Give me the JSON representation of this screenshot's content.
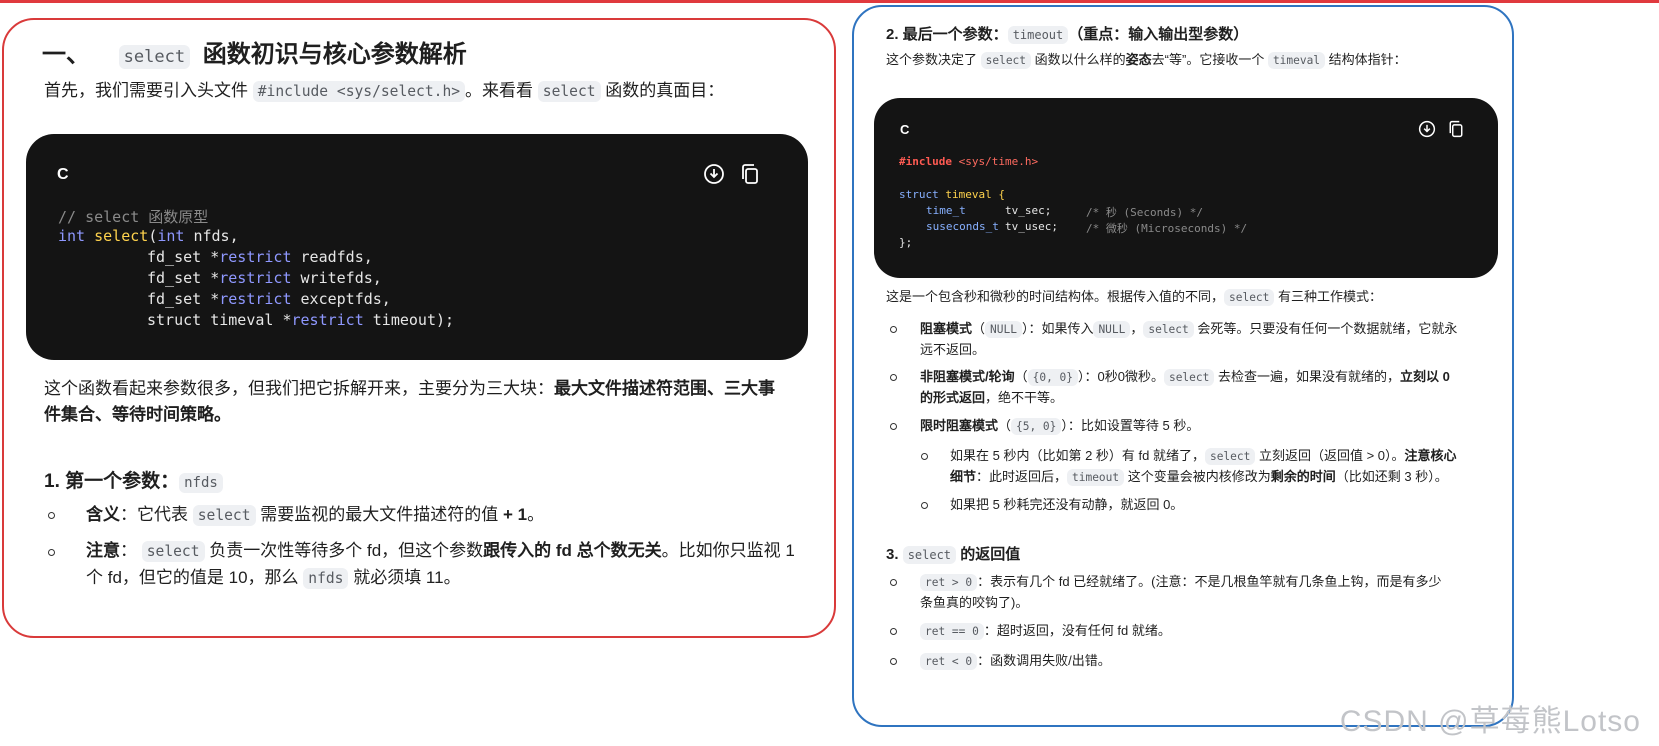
{
  "left": {
    "title_prefix": "一、",
    "title_code": "select",
    "title_suffix": "函数初识与核心参数解析",
    "intro_a": "首先，我们需要引入头文件",
    "intro_code1": "#include <sys/select.h>",
    "intro_b": "。来看看",
    "intro_code2": "select",
    "intro_c": "函数的真面目：",
    "code": {
      "lang": "C",
      "comment": "// select 函数原型",
      "l1_kw1": "int",
      "l1_fn": "select",
      "l1_paren": "(",
      "l1_kw2": "int",
      "l1_rest": " nfds,",
      "l2_a": "fd_set *",
      "l2_kw": "restrict",
      "l2_b": " readfds,",
      "l3_a": "fd_set *",
      "l3_kw": "restrict",
      "l3_b": " writefds,",
      "l4_a": "fd_set *",
      "l4_kw": "restrict",
      "l4_b": " exceptfds,",
      "l5_a": "struct timeval *",
      "l5_kw": "restrict",
      "l5_b": " timeout);"
    },
    "summary_a": "这个函数看起来参数很多，但我们把它拆解开来，主要分为三大块：",
    "summary_bold1": "最大文件描述符范围、三大事",
    "summary_bold2": "件集合、等待时间策略。",
    "sec1_prefix": "1. 第一个参数：",
    "sec1_code": "nfds",
    "item1_label": "含义",
    "item1_a": "：它代表",
    "item1_code": "select",
    "item1_b": "需要监视的最大文件描述符的值",
    "item1_bold": " + 1",
    "item1_c": "。",
    "item2_label": "注意",
    "item2_a": "：",
    "item2_code": "select",
    "item2_b": "负责一次性等待多个 fd，但这个参数",
    "item2_bold": "跟传入的 fd 总个数无关",
    "item2_c": "。比如你只监视 1",
    "item2_line2_a": "个 fd，但它的值是 10，那么",
    "item2_code2": "nfds",
    "item2_line2_b": "就必须填 11。"
  },
  "right": {
    "sec2_prefix": "2. 最后一个参数：",
    "sec2_code": "timeout",
    "sec2_suffix": "（重点：输入输出型参数）",
    "sec2_desc_a": "这个参数决定了",
    "sec2_desc_code": "select",
    "sec2_desc_b": "函数以什么样的",
    "sec2_desc_bold": "姿态",
    "sec2_desc_c": "去“等”。它接收一个",
    "sec2_desc_code2": "timeval",
    "sec2_desc_d": "结构体指针：",
    "code": {
      "lang": "C",
      "l1_inc": "#include",
      "l1_hdr": " <sys/time.h>",
      "l2_kw": "struct",
      "l2_name": " timeval {",
      "l3_type": "time_t",
      "l3_field": "tv_sec;",
      "l3_cm": "/* 秒 (Seconds) */",
      "l4_type": "suseconds_t",
      "l4_field": "tv_usec;",
      "l4_cm": "/* 微秒 (Microseconds) */",
      "l5": "};"
    },
    "modes_a": "这是一个包含秒和微秒的时间结构体。根据传入值的不同，",
    "modes_code": "select",
    "modes_b": "有三种工作模式：",
    "m1_bold": "阻塞模式",
    "m1_p1": "（",
    "m1_code": "NULL",
    "m1_p2": "）：如果传入",
    "m1_code2": "NULL",
    "m1_p3": "，",
    "m1_code3": "select",
    "m1_p4": "会死等。只要没有任何一个数据就绪，它就永",
    "m1_line2": "远不返回。",
    "m2_bold": "非阻塞模式/轮询",
    "m2_p1": "（",
    "m2_code": "{0, 0}",
    "m2_p2": "）：0秒0微秒。",
    "m2_code2": "select",
    "m2_p3": "去检查一遍，如果没有就绪的，",
    "m2_bold2": "立刻以 0",
    "m2_line2_bold": "的形式返回",
    "m2_line2": "，绝不干等。",
    "m3_bold": "限时阻塞模式",
    "m3_p1": "（",
    "m3_code": "{5, 0}",
    "m3_p2": "）：比如设置等待 5 秒。",
    "s1_a": "如果在 5 秒内（比如第 2 秒）有 fd 就绪了，",
    "s1_code": "select",
    "s1_b": "立刻返回（返回值 > 0）。",
    "s1_bold": "注意核心",
    "s1_line2_bold": "细节",
    "s1_line2_a": "：此时返回后，",
    "s1_line2_code": "timeout",
    "s1_line2_b": "这个变量会被内核修改为",
    "s1_line2_bold2": "剩余的时间",
    "s1_line2_c": "（比如还剩 3 秒）。",
    "s2": "如果把 5 秒耗完还没有动静，就返回 0。",
    "sec3_prefix": "3.",
    "sec3_code": "select",
    "sec3_suffix": "的返回值",
    "r1_code": "ret > 0",
    "r1_text": "：表示有几个 fd 已经就绪了。(注意：不是几根鱼竿就有几条鱼上钩，而是有多少",
    "r1_line2": "条鱼真的咬钩了)。",
    "r2_code": "ret == 0",
    "r2_text": "：超时返回，没有任何 fd 就绪。",
    "r3_code": "ret < 0",
    "r3_text": "：函数调用失败/出错。"
  },
  "watermark": "CSDN @草莓熊Lotso"
}
